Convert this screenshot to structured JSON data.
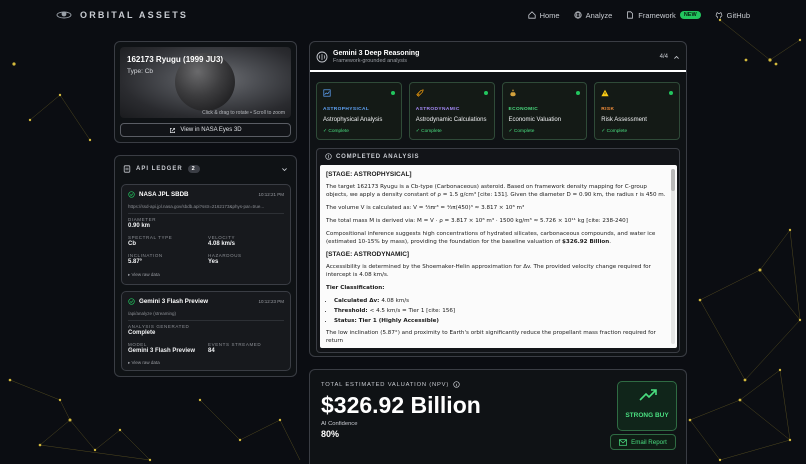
{
  "app": {
    "title": "ORBITAL ASSETS"
  },
  "nav": {
    "home": "Home",
    "analyze": "Analyze",
    "framework": "Framework",
    "framework_badge": "NEW",
    "github": "GitHub"
  },
  "asset": {
    "title": "162173 Ryugu (1999 JU3)",
    "type": "Type: Cb",
    "hint": "Click & drag to rotate • Scroll to zoom",
    "nasa_button": "View in NASA Eyes 3D"
  },
  "ledger": {
    "title": "API LEDGER",
    "count": "2",
    "entries": [
      {
        "title": "NASA JPL SBDB",
        "time": "10:12:21 PM",
        "url": "https://ssd-api.jpl.nasa.gov/sbdb.api?sstr=2162173&phys-par=true...",
        "fields": [
          {
            "k": "DIAMETER",
            "v": "0.90 km"
          },
          {
            "k": "SPECTRAL TYPE",
            "v": "Cb"
          },
          {
            "k": "VELOCITY",
            "v": "4.08 km/s"
          },
          {
            "k": "INCLINATION",
            "v": "5.87°"
          },
          {
            "k": "HAZARDOUS",
            "v": "Yes"
          }
        ],
        "raw": "▸ View raw data"
      },
      {
        "title": "Gemini 3 Flash Preview",
        "time": "10:12:23 PM",
        "url": "/api/analyze (streaming)",
        "fields": [
          {
            "k": "ANALYSIS GENERATED",
            "v": "Complete"
          },
          {
            "k": "MODEL",
            "v": "Gemini 3 Flash Preview"
          },
          {
            "k": "EVENTS STREAMED",
            "v": "84"
          }
        ],
        "raw": "▸ View raw data"
      }
    ]
  },
  "reasoning": {
    "title": "Gemini 3 Deep Reasoning",
    "subtitle": "Framework-grounded analysis",
    "page": "4/4",
    "cards": [
      {
        "category": "ASTROPHYSICAL",
        "name": "Astrophysical Analysis",
        "status": "✓ Complete",
        "color": "#60a5fa"
      },
      {
        "category": "ASTRODYNAMIC",
        "name": "Astrodynamic Calculations",
        "status": "✓ Complete",
        "color": "#a78bfa"
      },
      {
        "category": "ECONOMIC",
        "name": "Economic Valuation",
        "status": "✓ Complete",
        "color": "#4ade80"
      },
      {
        "category": "RISK",
        "name": "Risk Assessment",
        "status": "✓ Complete",
        "color": "#fb923c"
      }
    ],
    "analysis_title": "COMPLETED ANALYSIS",
    "doc": {
      "s1": "[STAGE: ASTROPHYSICAL]",
      "p1": "The target 162173 Ryugu is a Cb-type (Carbonaceous) asteroid. Based on framework density mapping for C-group objects, we apply a density constant of ρ = 1.5 g/cm³ [cite: 131]. Given the diameter D = 0.90 km, the radius r is 450 m.",
      "p2": "The volume V is calculated as: V = ⁴⁄₃πr³ = ⁴⁄₃π(450)³ ≈ 3.817 × 10⁸ m³",
      "p3": "The total mass M is derived via: M = V · ρ = 3.817 × 10⁸ m³ · 1500 kg/m³ ≈ 5.726 × 10¹¹ kg [cite: 238-240]",
      "p4a": "Compositional inference suggests high concentrations of hydrated silicates, carbonaceous compounds, and water ice (estimated 10-15% by mass), providing the foundation for the baseline valuation of ",
      "p4b": "$326.92 Billion",
      "p4c": ".",
      "s2": "[STAGE: ASTRODYNAMIC]",
      "p5": "Accessibility is determined by the Shoemaker-Helin approximation for Δv. The provided velocity change required for intercept is 4.08 km/s.",
      "p6": "Tier Classification:",
      "li1a": "Calculated Δv: ",
      "li1b": "4.08 km/s",
      "li2a": "Threshold: ",
      "li2b": "< 4.5 km/s = Tier 1 [cite: 156]",
      "li3a": "Status: Tier 1 (Highly Accessible)",
      "p7": "The low inclination (5.87°) and proximity to Earth's orbit significantly reduce the propellant mass fraction required for return"
    }
  },
  "valuation": {
    "label": "TOTAL ESTIMATED VALUATION (NPV)",
    "amount": "$326.92 Billion",
    "confidence_label": "AI Confidence",
    "confidence": "80%",
    "rating": "STRONG BUY",
    "email_button": "Email Report"
  },
  "colors": {
    "accent": "#22c55e",
    "constellation": "#d4b93c",
    "background": "#0b0d12"
  }
}
